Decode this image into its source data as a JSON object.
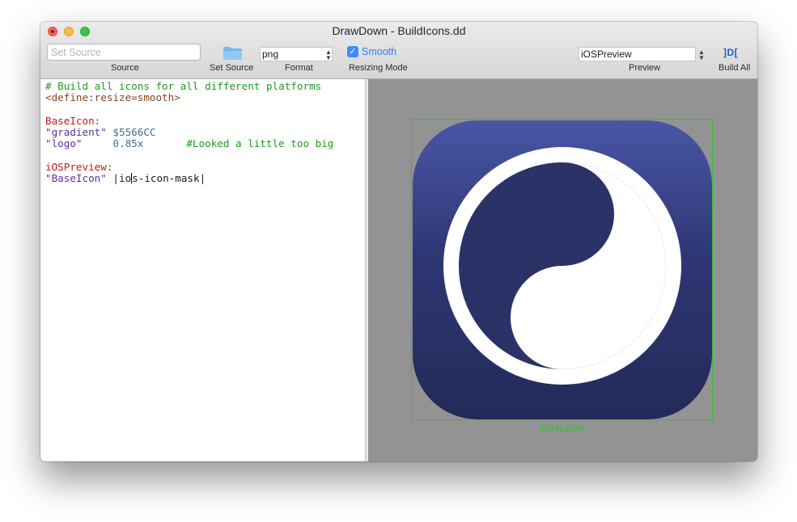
{
  "window": {
    "title": "DrawDown - BuildIcons.dd"
  },
  "toolbar": {
    "source_placeholder": "Set Source",
    "source_label": "Source",
    "set_source_label": "Set Source",
    "format_value": "png",
    "format_label": "Format",
    "smooth_label": "Smooth",
    "smooth_checked": true,
    "resizing_label": "Resizing Mode",
    "preview_value": "iOSPreview",
    "preview_label": "Preview",
    "build_icon_glyph": "]D[",
    "build_all_label": "Build All"
  },
  "editor": {
    "line1": "# Build all icons for all different platforms",
    "line2": "<define:resize=smooth>",
    "line4": "BaseIcon:",
    "line5_key": "\"gradient\"",
    "line5_value": " $5566CC",
    "line6_key": "\"logo\"",
    "line6_value": "     0.85x",
    "line6_comment": "       #Looked a little too big",
    "line8": "iOSPreview:",
    "line9_key": "\"BaseIcon\"",
    "line9_pre": " |io",
    "line9_post": "s-icon-mask|"
  },
  "preview": {
    "size_label": "1024x1024",
    "gradient_top": "#4a56a6",
    "gradient_bottom": "#232a58",
    "frame_color": "#2cc32c"
  },
  "colors": {
    "comment": "#1e9a1e",
    "section": "#c51a17",
    "string": "#5b2ea0",
    "accent": "#3d8af7"
  }
}
